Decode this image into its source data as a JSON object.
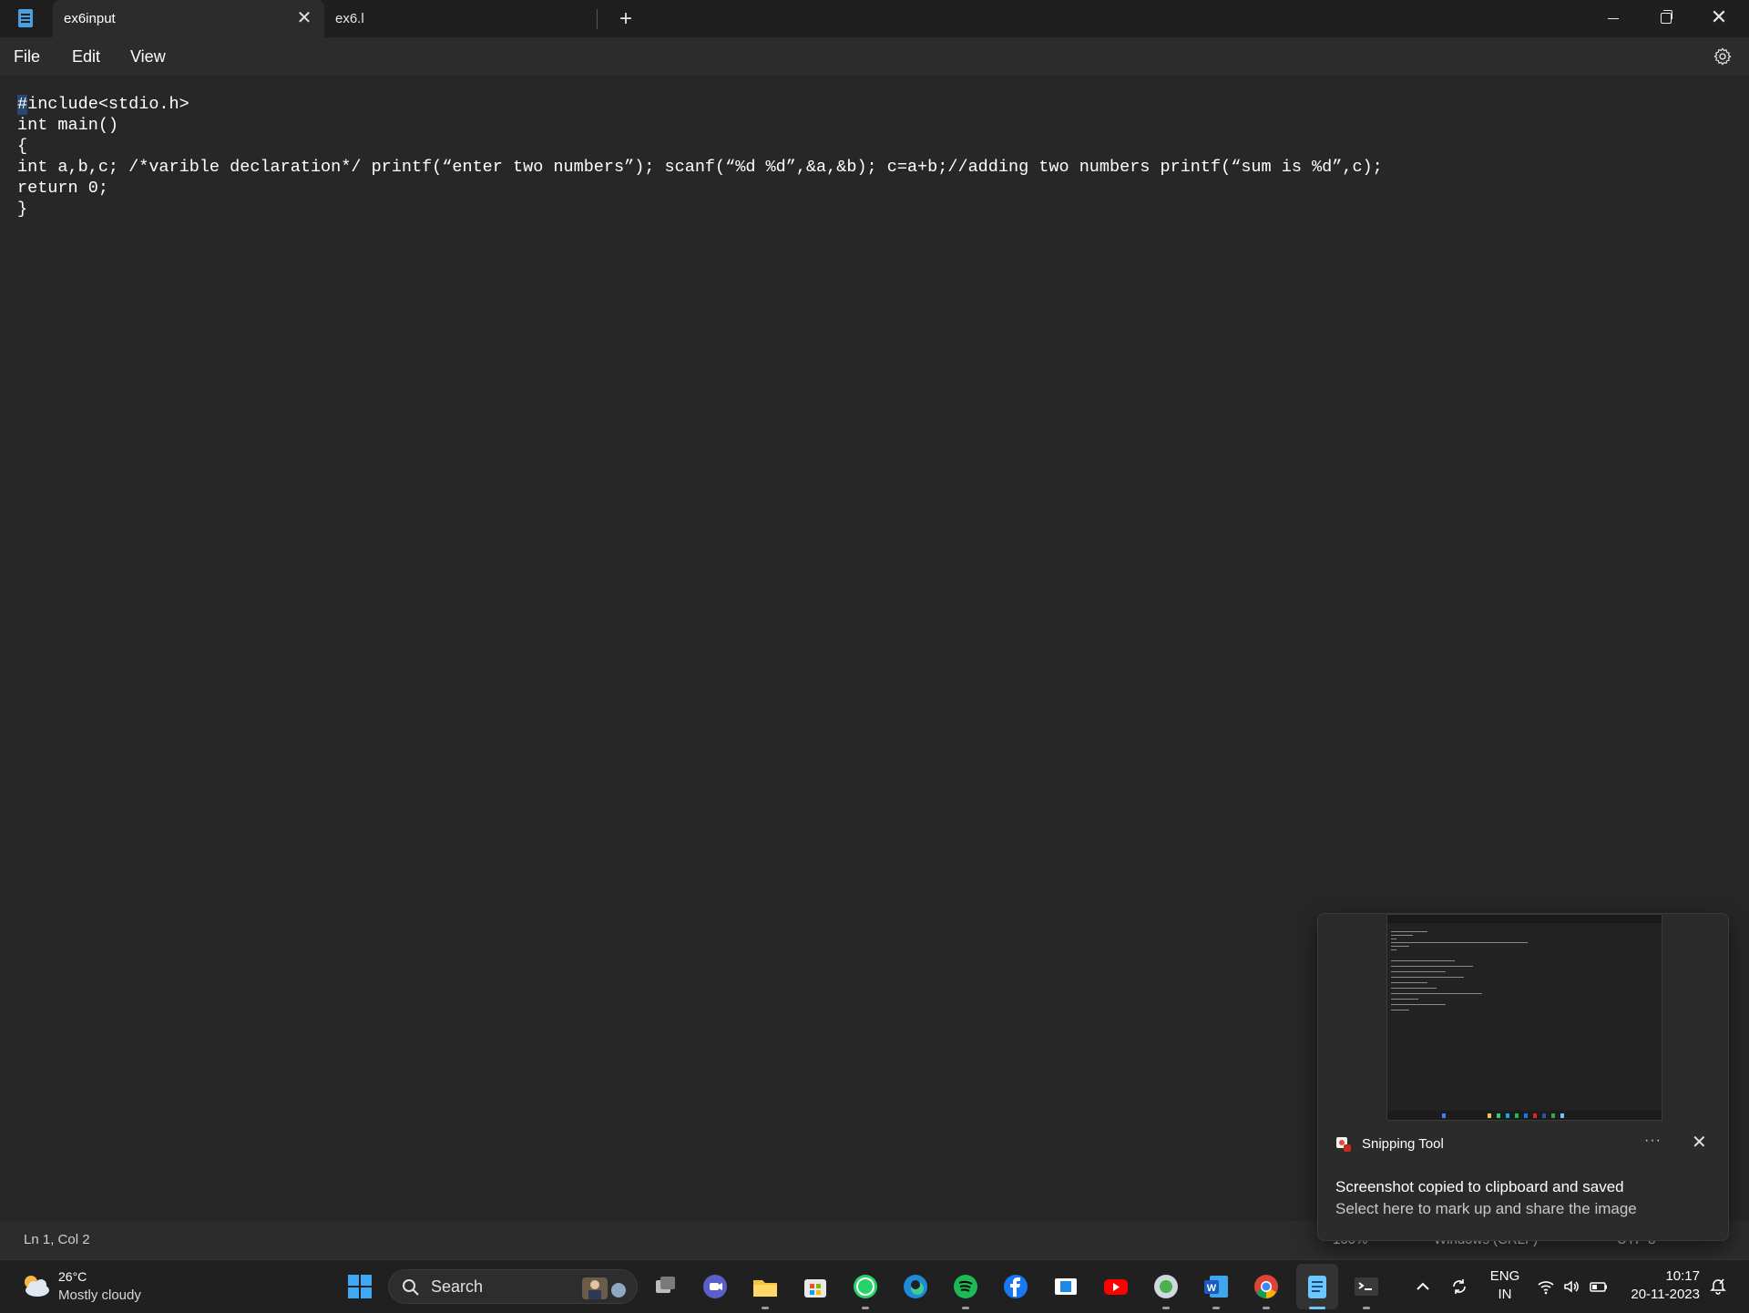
{
  "window": {
    "tabs": [
      {
        "label": "ex6input",
        "active": true
      },
      {
        "label": "ex6.l",
        "active": false
      }
    ],
    "close_tab_glyph": "✕",
    "new_tab_glyph": "+",
    "close_glyph": "✕"
  },
  "menu": {
    "file": "File",
    "edit": "Edit",
    "view": "View"
  },
  "editor": {
    "lines": [
      "#include<stdio.h>",
      "int main()",
      "{",
      "int a,b,c; /*varible declaration*/ printf(“enter two numbers”); scanf(“%d %d”,&a,&b); c=a+b;//adding two numbers printf(“sum is %d”,c);",
      "return 0;",
      "}"
    ]
  },
  "status": {
    "position": "Ln 1, Col 2",
    "zoom": "100%",
    "line_ending": "Windows (CRLF)",
    "encoding": "UTF-8"
  },
  "toast": {
    "app_name": "Snipping Tool",
    "more_glyph": "···",
    "close_glyph": "✕",
    "title": "Screenshot copied to clipboard and saved",
    "body": "Select here to mark up and share the image"
  },
  "taskbar": {
    "weather_temp": "26°C",
    "weather_desc": "Mostly cloudy",
    "search_label": "Search",
    "language": "ENG",
    "region": "IN",
    "time": "10:17",
    "date": "20-11-2023",
    "apps": [
      "start-icon",
      "task-view-icon",
      "teams-icon",
      "file-explorer-icon",
      "store-icon",
      "whatsapp-icon",
      "edge-icon",
      "spotify-icon",
      "facebook-icon",
      "app-icon",
      "youtube-icon",
      "app-icon",
      "word-icon",
      "chrome-icon",
      "notepad-icon",
      "terminal-icon"
    ]
  },
  "colors": {
    "background": "#272727",
    "titlebar": "#1f1f1f",
    "accent": "#6cc6ff"
  }
}
